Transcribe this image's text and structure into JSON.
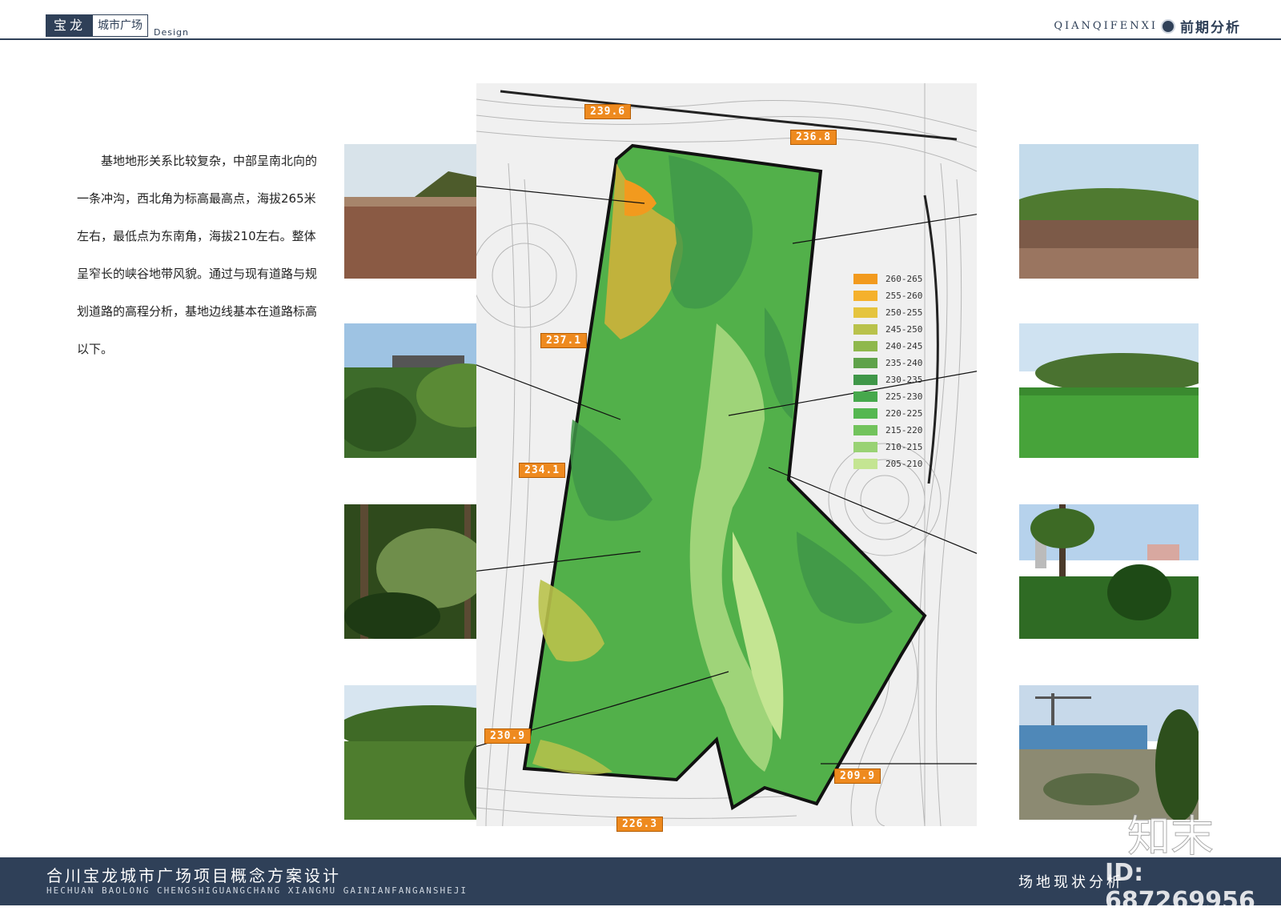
{
  "header": {
    "brand": "宝龙",
    "brand_sub": "城市广场",
    "design": "Design",
    "section_en": "QIANQIFENXI",
    "section_cn": "前期分析"
  },
  "description": [
    "基地地形关系比较复杂，中部呈南北向的一条冲沟，西北角为标高最高点，海拔265米左右，最低点为东南角，海拔210左右。整体呈窄长的峡谷地带风貌。通过与现有道路与规划道路的高程分析，基地边线基本在道路标高以下。"
  ],
  "elevations": [
    "239.6",
    "236.8",
    "237.1",
    "234.1",
    "230.9",
    "209.9",
    "226.3"
  ],
  "legend": [
    {
      "label": "260-265",
      "color": "#f29a1e"
    },
    {
      "label": "255-260",
      "color": "#f5b12c"
    },
    {
      "label": "250-255",
      "color": "#e5c43e"
    },
    {
      "label": "245-250",
      "color": "#b9c24b"
    },
    {
      "label": "240-245",
      "color": "#8fb84c"
    },
    {
      "label": "235-240",
      "color": "#5fa24a"
    },
    {
      "label": "230-235",
      "color": "#3f9748"
    },
    {
      "label": "225-230",
      "color": "#46a84c"
    },
    {
      "label": "220-225",
      "color": "#55b751"
    },
    {
      "label": "215-220",
      "color": "#72c35c"
    },
    {
      "label": "210-215",
      "color": "#99d274"
    },
    {
      "label": "205-210",
      "color": "#c4e592"
    }
  ],
  "footer": {
    "title": "合川宝龙城市广场项目概念方案设计",
    "subtitle": "HECHUAN BAOLONG CHENGSHIGUANGCHANG  XIANGMU GAINIANFANGANSHEJI",
    "section": "场地现状分析"
  },
  "watermark": {
    "id": "ID: 687269956",
    "logo": "知末"
  }
}
